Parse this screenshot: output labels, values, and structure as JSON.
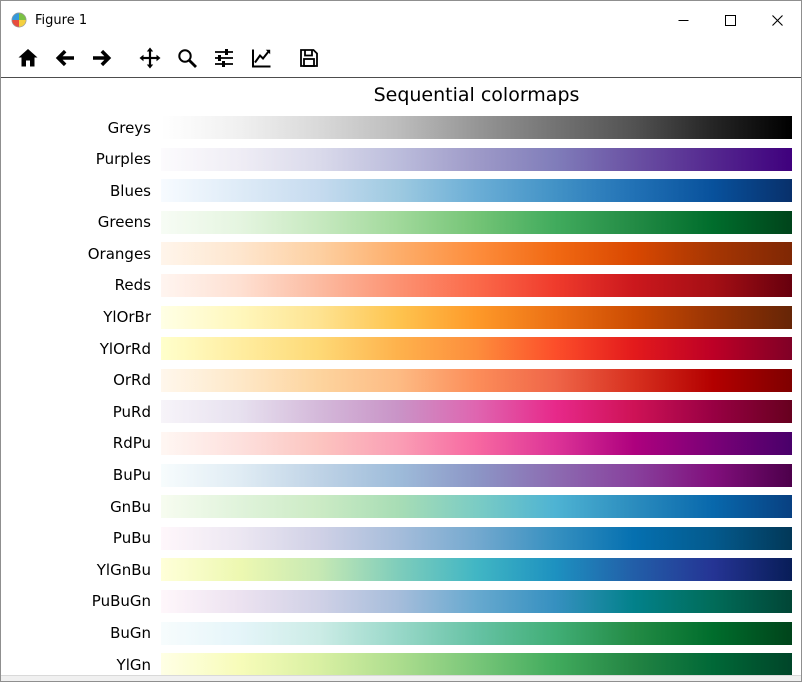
{
  "window": {
    "title": "Figure 1",
    "controls": [
      "minimize",
      "maximize",
      "close"
    ]
  },
  "toolbar": {
    "icons": [
      "home",
      "back",
      "forward",
      "pan",
      "zoom",
      "subplots",
      "customize",
      "save"
    ]
  },
  "chart_data": {
    "type": "heatmap",
    "title": "Sequential colormaps",
    "note": "Horizontal gradient strips, one per matplotlib sequential colormap, labels right-aligned at left of each strip",
    "rows": [
      {
        "label": "Greys",
        "stops": [
          "#ffffff",
          "#f0f0f0",
          "#d9d9d9",
          "#bdbdbd",
          "#969696",
          "#737373",
          "#525252",
          "#252525",
          "#000000"
        ]
      },
      {
        "label": "Purples",
        "stops": [
          "#fcfbfd",
          "#efedf5",
          "#dadaeb",
          "#bcbddc",
          "#9e9ac8",
          "#807dba",
          "#6a51a3",
          "#54278f",
          "#3f007d"
        ]
      },
      {
        "label": "Blues",
        "stops": [
          "#f7fbff",
          "#deebf7",
          "#c6dbef",
          "#9ecae1",
          "#6baed6",
          "#4292c6",
          "#2171b5",
          "#08519c",
          "#08306b"
        ]
      },
      {
        "label": "Greens",
        "stops": [
          "#f7fcf5",
          "#e5f5e0",
          "#c7e9c0",
          "#a1d99b",
          "#74c476",
          "#41ab5d",
          "#238b45",
          "#006d2c",
          "#00441b"
        ]
      },
      {
        "label": "Oranges",
        "stops": [
          "#fff5eb",
          "#fee6ce",
          "#fdd0a2",
          "#fdae6b",
          "#fd8d3c",
          "#f16913",
          "#d94801",
          "#a63603",
          "#7f2704"
        ]
      },
      {
        "label": "Reds",
        "stops": [
          "#fff5f0",
          "#fee0d2",
          "#fcbba1",
          "#fc9272",
          "#fb6a4a",
          "#ef3b2c",
          "#cb181d",
          "#a50f15",
          "#67000d"
        ]
      },
      {
        "label": "YlOrBr",
        "stops": [
          "#ffffe5",
          "#fff7bc",
          "#fee391",
          "#fec44f",
          "#fe9929",
          "#ec7014",
          "#cc4c02",
          "#993404",
          "#662506"
        ]
      },
      {
        "label": "YlOrRd",
        "stops": [
          "#ffffcc",
          "#ffeda0",
          "#fed976",
          "#feb24c",
          "#fd8d3c",
          "#fc4e2a",
          "#e31a1c",
          "#bd0026",
          "#800026"
        ]
      },
      {
        "label": "OrRd",
        "stops": [
          "#fff7ec",
          "#fee8c8",
          "#fdd49e",
          "#fdbb84",
          "#fc8d59",
          "#ef6548",
          "#d7301f",
          "#b30000",
          "#7f0000"
        ]
      },
      {
        "label": "PuRd",
        "stops": [
          "#f7f4f9",
          "#e7e1ef",
          "#d4b9da",
          "#c994c7",
          "#df65b0",
          "#e7298a",
          "#ce1256",
          "#980043",
          "#67001f"
        ]
      },
      {
        "label": "RdPu",
        "stops": [
          "#fff7f3",
          "#fde0dd",
          "#fcc5c0",
          "#fa9fb5",
          "#f768a1",
          "#dd3497",
          "#ae017e",
          "#7a0177",
          "#49006a"
        ]
      },
      {
        "label": "BuPu",
        "stops": [
          "#f7fcfd",
          "#e0ecf4",
          "#bfd3e6",
          "#9ebcda",
          "#8c96c6",
          "#8c6bb1",
          "#88419d",
          "#810f7c",
          "#4d004b"
        ]
      },
      {
        "label": "GnBu",
        "stops": [
          "#f7fcf0",
          "#e0f3db",
          "#ccebc5",
          "#a8ddb5",
          "#7bccc4",
          "#4eb3d3",
          "#2b8cbe",
          "#0868ac",
          "#084081"
        ]
      },
      {
        "label": "PuBu",
        "stops": [
          "#fff7fb",
          "#ece7f2",
          "#d0d1e6",
          "#a6bddb",
          "#74a9cf",
          "#3690c0",
          "#0570b0",
          "#045a8d",
          "#023858"
        ]
      },
      {
        "label": "YlGnBu",
        "stops": [
          "#ffffd9",
          "#edf8b1",
          "#c7e9b4",
          "#7fcdbb",
          "#41b6c4",
          "#1d91c0",
          "#225ea8",
          "#253494",
          "#081d58"
        ]
      },
      {
        "label": "PuBuGn",
        "stops": [
          "#fff7fb",
          "#ece2f0",
          "#d0d1e6",
          "#a6bddb",
          "#67a9cf",
          "#3690c0",
          "#02818a",
          "#016c59",
          "#014636"
        ]
      },
      {
        "label": "BuGn",
        "stops": [
          "#f7fcfd",
          "#e5f5f9",
          "#ccece6",
          "#99d8c9",
          "#66c2a4",
          "#41ae76",
          "#238b45",
          "#006d2c",
          "#00441b"
        ]
      },
      {
        "label": "YlGn",
        "stops": [
          "#ffffe5",
          "#f7fcb9",
          "#d9f0a3",
          "#addd8e",
          "#78c679",
          "#41ab5d",
          "#238443",
          "#006837",
          "#004529"
        ]
      }
    ]
  }
}
